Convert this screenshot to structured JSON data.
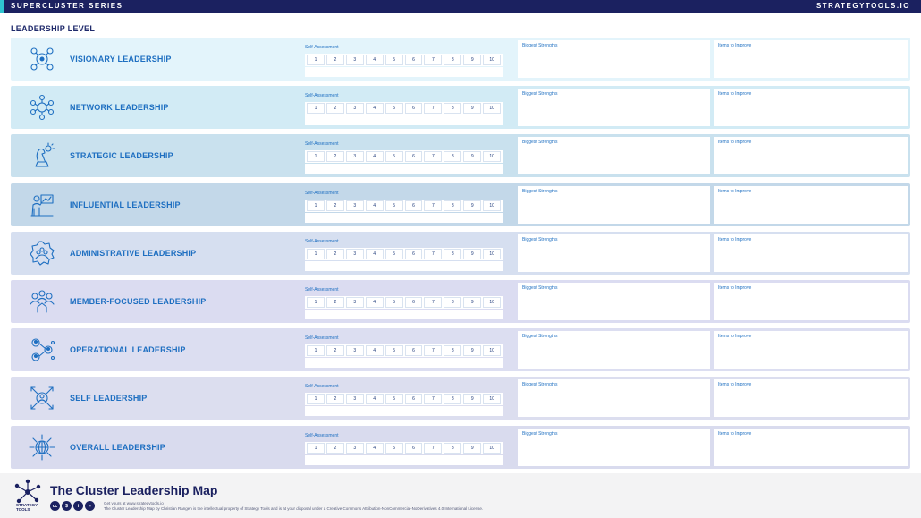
{
  "header": {
    "series": "SUPERCLUSTER SERIES",
    "site": "STRATEGYTOOLS.IO"
  },
  "section_title": "LEADERSHIP LEVEL",
  "field_labels": {
    "self_assessment": "Self-Assessment",
    "strengths": "Biggest Strengths",
    "improve": "Items to Improve"
  },
  "scale": [
    "1",
    "2",
    "3",
    "4",
    "5",
    "6",
    "7",
    "8",
    "9",
    "10"
  ],
  "rows": [
    {
      "label": "VISIONARY LEADERSHIP",
      "icon": "visionary-icon",
      "color": "#e3f4fb"
    },
    {
      "label": "NETWORK LEADERSHIP",
      "icon": "network-icon",
      "color": "#d2ebf5"
    },
    {
      "label": "STRATEGIC LEADERSHIP",
      "icon": "strategic-icon",
      "color": "#c9e1ee"
    },
    {
      "label": "INFLUENTIAL LEADERSHIP",
      "icon": "influential-icon",
      "color": "#c3d8e9"
    },
    {
      "label": "ADMINISTRATIVE LEADERSHIP",
      "icon": "administrative-icon",
      "color": "#d6dff0"
    },
    {
      "label": "MEMBER-FOCUSED LEADERSHIP",
      "icon": "member-focused-icon",
      "color": "#dbdcf1"
    },
    {
      "label": "OPERATIONAL LEADERSHIP",
      "icon": "operational-icon",
      "color": "#dcdef1"
    },
    {
      "label": "SELF LEADERSHIP",
      "icon": "self-icon",
      "color": "#dcdeef"
    },
    {
      "label": "OVERALL LEADERSHIP",
      "icon": "overall-icon",
      "color": "#d9dbee"
    }
  ],
  "footer": {
    "title": "The Cluster Leadership Map",
    "logo_line1": "STRATEGY",
    "logo_line2": "TOOLS",
    "get_yours": "Get yours at www.strategytools.io",
    "legal": "The Cluster Leadership Map by Christian Rangen is the intellectual property of Strategy Tools and is at your disposal under a Creative Commons Attribution-NonCommercial-NoDerivatives 4.0 International License.",
    "cc_icons": [
      "cc",
      "$",
      "i",
      "="
    ]
  },
  "colors": {
    "navy": "#1b2160",
    "accent": "#2fc4d0",
    "label_blue": "#1e6fc1"
  }
}
